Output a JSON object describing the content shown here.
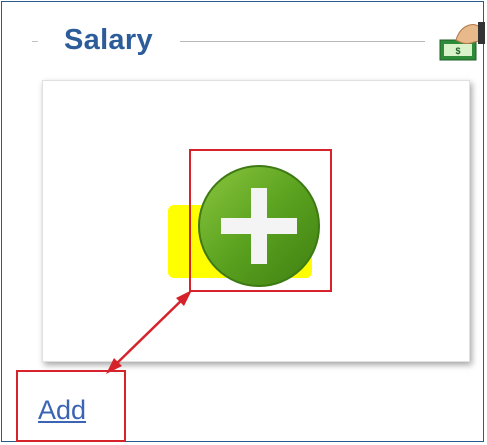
{
  "panel": {
    "title": "Salary",
    "header_icon": "money-hand-icon"
  },
  "card": {
    "add_icon": "green-plus-circle-icon",
    "add_link_label": "Add"
  },
  "annotation": {
    "callout_color": "#d6232b",
    "highlight_color": "#ffff00"
  },
  "colors": {
    "title": "#2c5d9a",
    "link": "#3b64b5",
    "plus_green": "#5aa21f"
  }
}
